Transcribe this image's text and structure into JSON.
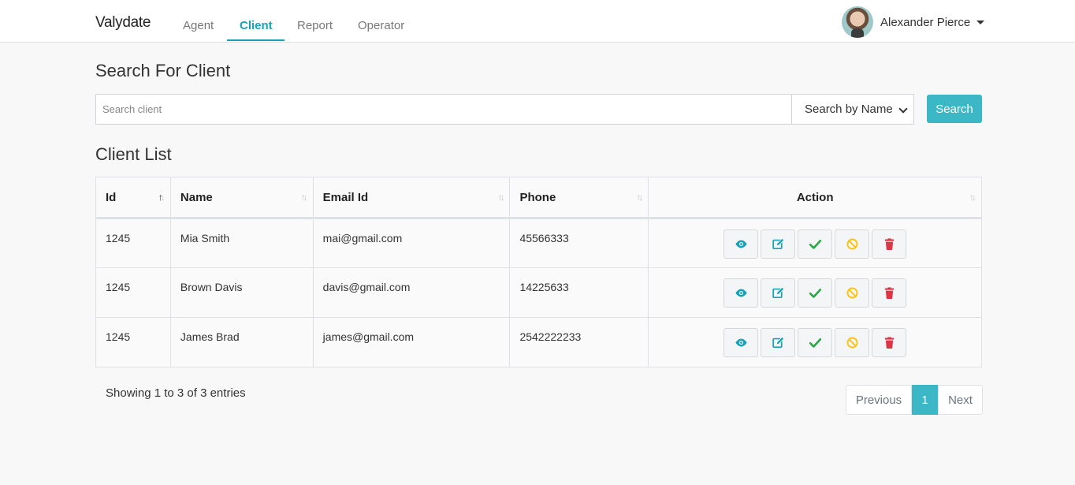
{
  "navbar": {
    "brand": "Valydate",
    "links": [
      {
        "label": "Agent",
        "active": false
      },
      {
        "label": "Client",
        "active": true
      },
      {
        "label": "Report",
        "active": false
      },
      {
        "label": "Operator",
        "active": false
      }
    ],
    "user": {
      "name": "Alexander Pierce"
    }
  },
  "search": {
    "heading": "Search For Client",
    "placeholder": "Search client",
    "value": "",
    "select_value": "Search by Name",
    "button_label": "Search"
  },
  "client_list": {
    "heading": "Client List",
    "columns": [
      "Id",
      "Name",
      "Email Id",
      "Phone",
      "Action"
    ],
    "rows": [
      {
        "id": "1245",
        "name": "Mia Smith",
        "email": "mai@gmail.com",
        "phone": "45566333"
      },
      {
        "id": "1245",
        "name": "Brown Davis",
        "email": "davis@gmail.com",
        "phone": "14225633"
      },
      {
        "id": "1245",
        "name": "James Brad",
        "email": "james@gmail.com",
        "phone": "2542222233"
      }
    ],
    "action_icons": [
      "eye-icon",
      "edit-icon",
      "check-icon",
      "ban-icon",
      "trash-icon"
    ]
  },
  "footer": {
    "showing_text": "Showing 1 to 3 of 3 entries",
    "pagination": {
      "previous": "Previous",
      "current_page": "1",
      "next": "Next"
    }
  },
  "colors": {
    "accent": "#17a2b8",
    "button": "#3bb7c6",
    "view": "#17a2b8",
    "edit": "#17a2b8",
    "approve": "#28a745",
    "block": "#ffc107",
    "delete": "#dc3545"
  }
}
